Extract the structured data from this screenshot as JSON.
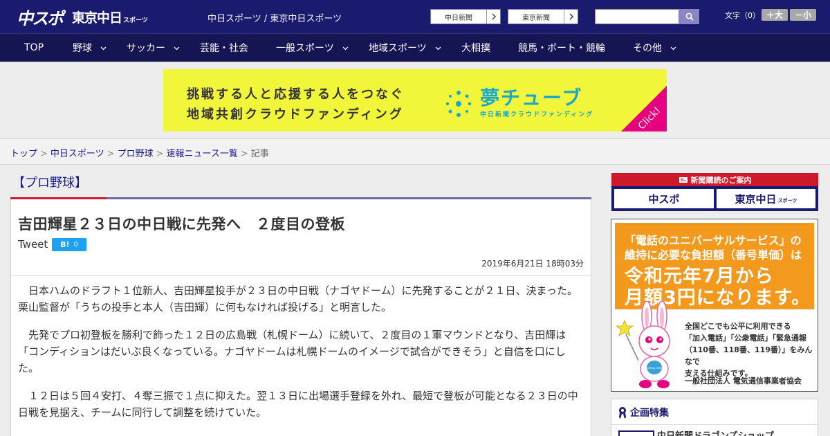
{
  "header": {
    "logo_main": "中スポ",
    "logo_tokyo": "東京中日",
    "logo_sports": "スポーツ",
    "site_links": "中日スポーツ / 東京中日スポーツ",
    "paper_buttons": [
      "中日新聞",
      "東京新聞"
    ],
    "search_icon": "search-icon",
    "font_size_label": "文字（0）",
    "font_larger": "＋大",
    "font_smaller": "－小",
    "color_bg": "#1a1a6e"
  },
  "nav": {
    "items": [
      {
        "label": "TOP",
        "dropdown": false
      },
      {
        "label": "野球",
        "dropdown": true
      },
      {
        "label": "サッカー",
        "dropdown": true
      },
      {
        "label": "芸能・社会",
        "dropdown": false
      },
      {
        "label": "一般スポーツ",
        "dropdown": true
      },
      {
        "label": "地域スポーツ",
        "dropdown": true
      },
      {
        "label": "大相撲",
        "dropdown": false
      },
      {
        "label": "競馬・ボート・競輪",
        "dropdown": false
      },
      {
        "label": "その他",
        "dropdown": true
      }
    ]
  },
  "banner": {
    "line1": "挑戦する人と応援する人をつなぐ",
    "line2": "地域共創クラウドファンディング",
    "brand": "夢チューブ",
    "brand_sub": "中日新聞クラウドファンディング",
    "click": "Click!"
  },
  "breadcrumb": {
    "items": [
      "トップ",
      "中日スポーツ",
      "プロ野球",
      "速報ニュース一覧"
    ],
    "current": "記事",
    "separator": ">"
  },
  "article": {
    "category": "【プロ野球】",
    "headline": "吉田輝星２３日の中日戦に先発へ　２度目の登板",
    "tweet": "Tweet",
    "hatena_label": "B!",
    "hatena_count": "0",
    "date": "2019年6月21日 18時03分",
    "paragraphs": [
      "　日本ハムのドラフト１位新人、吉田輝星投手が２３日の中日戦（ナゴヤドーム）に先発することが２１日、決まった。栗山監督が「うちの投手と本人（吉田輝）に何もなければ投げる」と明言した。",
      "　先発でプロ初登板を勝利で飾った１２日の広島戦（札幌ドーム）に続いて、２度目の１軍マウンドとなり、吉田輝は「コンディションはだいぶ良くなっている。ナゴヤドームは札幌ドームのイメージで試合ができそう」と自信を口にした。",
      "　１２日は５回４安打、４奪三振で１点に抑えた。翌１３日に出場選手登録を外れ、最短で登板が可能となる２３日の中日戦を見据え、チームに同行して調整を続けていた。"
    ]
  },
  "sidebar": {
    "subscribe_title": "新聞購読のご案内",
    "subscribe_logos": [
      "中スポ",
      "東京中日"
    ],
    "subscribe_logo_sub": "スポーツ",
    "ad": {
      "line1": "「電話のユニバーサルサービス」の",
      "line2": "維持に必要な負担額（番号単価）は",
      "line3": "令和元年7月から",
      "line4": "月額3円になります。",
      "note": [
        "全国どこでも公平に利用できる",
        "「加入電話」「公衆電話」「緊急通報",
        "（110番、118番、119番）」をみんなで",
        "支える仕組みです。"
      ],
      "org": "一般社団法人 電気通信事業者協会",
      "mascot_label": "UNIVERSAL SERVICE"
    },
    "feature_title": "企画特集",
    "feature_item": "中日新聞ドラゴンズショップ"
  }
}
